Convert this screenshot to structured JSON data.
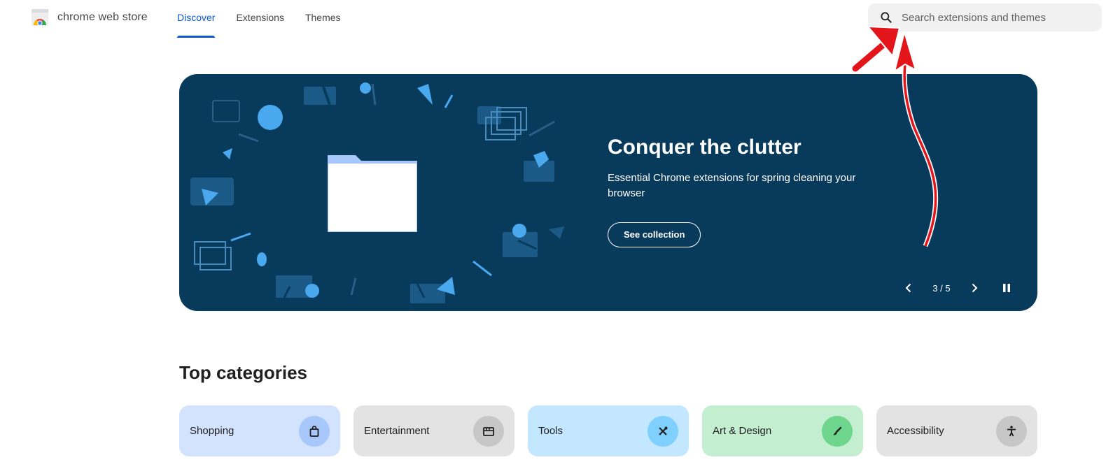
{
  "header": {
    "logo_text": "chrome web store",
    "tabs": [
      {
        "label": "Discover",
        "active": true
      },
      {
        "label": "Extensions",
        "active": false
      },
      {
        "label": "Themes",
        "active": false
      }
    ],
    "search": {
      "placeholder": "Search extensions and themes",
      "icon": "search-icon"
    }
  },
  "hero": {
    "title": "Conquer the clutter",
    "subtitle": "Essential Chrome extensions for spring cleaning your browser",
    "button_label": "See collection",
    "counter": "3 / 5",
    "background_color": "#083a5c"
  },
  "categories_section": {
    "title": "Top categories",
    "items": [
      {
        "label": "Shopping",
        "icon": "shopping-bag-icon",
        "bg": "#d3e3fd",
        "icon_bg": "#a8c7fa"
      },
      {
        "label": "Entertainment",
        "icon": "film-icon",
        "bg": "#e3e3e3",
        "icon_bg": "#c7c7c7"
      },
      {
        "label": "Tools",
        "icon": "tools-icon",
        "bg": "#c2e7ff",
        "icon_bg": "#7fcfff"
      },
      {
        "label": "Art & Design",
        "icon": "brush-icon",
        "bg": "#c4eed0",
        "icon_bg": "#6dd58c"
      },
      {
        "label": "Accessibility",
        "icon": "accessibility-icon",
        "bg": "#e3e3e3",
        "icon_bg": "#c7c7c7"
      }
    ]
  },
  "colors": {
    "accent": "#0b57d0",
    "annotation_arrow": "#e3151a"
  }
}
